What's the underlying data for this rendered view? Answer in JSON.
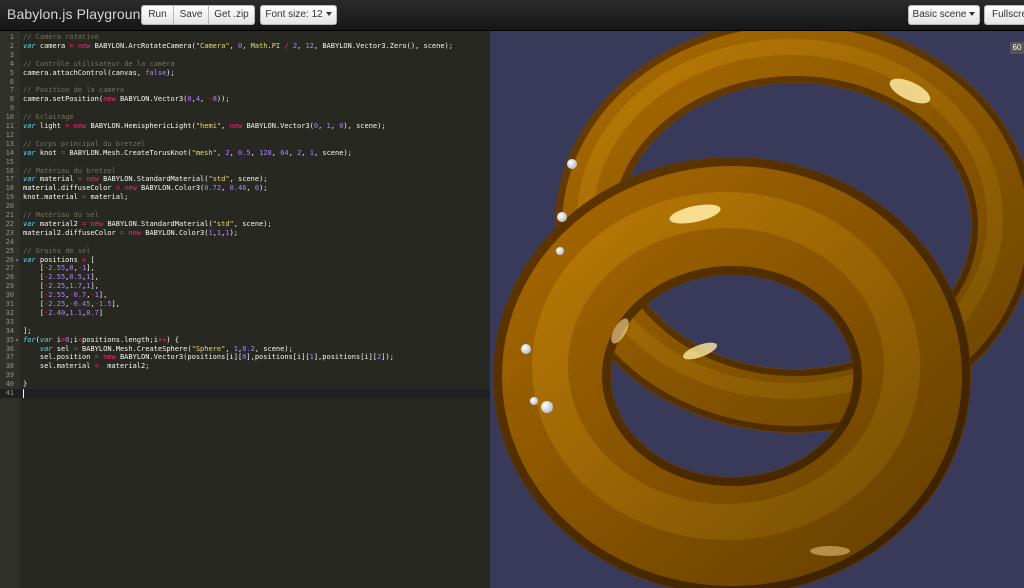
{
  "header": {
    "title": "Babylon.js Playground",
    "run_label": "Run",
    "save_label": "Save",
    "zip_label": "Get .zip",
    "font_size_label": "Font size: 12",
    "scene_label": "Basic scene",
    "fullscreen_label": "Fullscre"
  },
  "editor": {
    "active_line": 41,
    "lines": [
      {
        "n": "1",
        "code": "// Caméra rotative"
      },
      {
        "n": "2",
        "code": "var camera = new BABYLON.ArcRotateCamera(\"Camera\", 0, Math.PI / 2, 12, BABYLON.Vector3.Zero(), scene);"
      },
      {
        "n": "3",
        "code": ""
      },
      {
        "n": "4",
        "code": "// Contrôle utilisateur de la caméra"
      },
      {
        "n": "5",
        "code": "camera.attachControl(canvas, false);"
      },
      {
        "n": "6",
        "code": ""
      },
      {
        "n": "7",
        "code": "// Position de la camera"
      },
      {
        "n": "8",
        "code": "camera.setPosition(new BABYLON.Vector3(0,4, -8));"
      },
      {
        "n": "9",
        "code": ""
      },
      {
        "n": "10",
        "code": "// Eclairage"
      },
      {
        "n": "11",
        "code": "var light = new BABYLON.HemisphericLight(\"hemi\", new BABYLON.Vector3(0, 1, 0), scene);"
      },
      {
        "n": "12",
        "code": ""
      },
      {
        "n": "13",
        "code": "// Corps principal du bretzel"
      },
      {
        "n": "14",
        "code": "var knot = BABYLON.Mesh.CreateTorusKnot(\"mesh\", 2, 0.5, 128, 64, 2, 1, scene);"
      },
      {
        "n": "15",
        "code": ""
      },
      {
        "n": "16",
        "code": "// Matériau du bretzel"
      },
      {
        "n": "17",
        "code": "var material = new BABYLON.StandardMaterial(\"std\", scene);"
      },
      {
        "n": "18",
        "code": "material.diffuseColor = new BABYLON.Color3(0.72, 0.46, 0);"
      },
      {
        "n": "19",
        "code": "knot.material = material;"
      },
      {
        "n": "20",
        "code": ""
      },
      {
        "n": "21",
        "code": "// Matériau du sel"
      },
      {
        "n": "22",
        "code": "var material2 = new BABYLON.StandardMaterial(\"std\", scene);"
      },
      {
        "n": "23",
        "code": "material2.diffuseColor = new BABYLON.Color3(1,1,1);"
      },
      {
        "n": "24",
        "code": ""
      },
      {
        "n": "25",
        "code": "// Grains de sel"
      },
      {
        "n": "26",
        "code": "var positions = [",
        "fold": true
      },
      {
        "n": "27",
        "code": "    [-2.55,0,-1],"
      },
      {
        "n": "28",
        "code": "    [-2.55,0.5,1],"
      },
      {
        "n": "29",
        "code": "    [-2.25,1.7,1],"
      },
      {
        "n": "30",
        "code": "    [-2.55,-0.7,-1],"
      },
      {
        "n": "31",
        "code": "    [-2.25,-0.45,-1.5],"
      },
      {
        "n": "32",
        "code": "    [-2.40,1.1,0.7]"
      },
      {
        "n": "33",
        "code": ""
      },
      {
        "n": "34",
        "code": "];"
      },
      {
        "n": "35",
        "code": "for(var i=0;i<positions.length;i++) {",
        "fold": true
      },
      {
        "n": "36",
        "code": "    var sel = BABYLON.Mesh.CreateSphere(\"Sphere\", 1,0.2, scene);"
      },
      {
        "n": "37",
        "code": "    sel.position = new BABYLON.Vector3(positions[i][0],positions[i][1],positions[i][2]);"
      },
      {
        "n": "38",
        "code": "    sel.material =  material2;"
      },
      {
        "n": "39",
        "code": ""
      },
      {
        "n": "40",
        "code": "}"
      },
      {
        "n": "41",
        "code": ""
      }
    ]
  },
  "viewport": {
    "fps": "60",
    "background": "#393a5a",
    "knot_color": "#b06e00"
  }
}
